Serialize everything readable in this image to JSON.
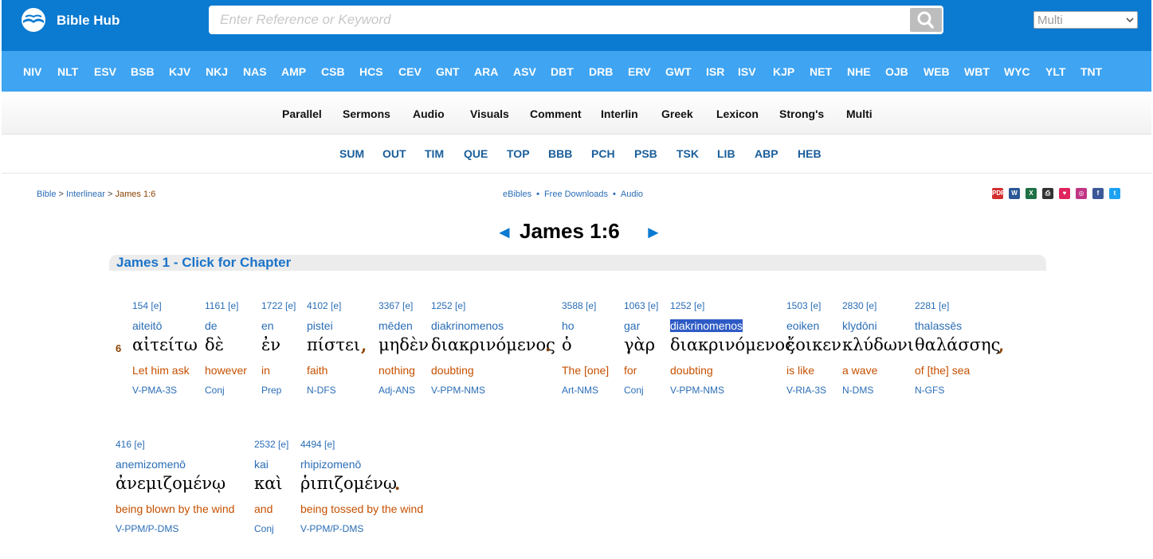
{
  "header": {
    "logo_text": "Bible Hub",
    "search_placeholder": "Enter Reference or Keyword",
    "select_value": "Multi"
  },
  "versions": [
    "NIV",
    "NLT",
    "ESV",
    "BSB",
    "KJV",
    "NKJ",
    "NAS",
    "AMP",
    "CSB",
    "HCS",
    "CEV",
    "GNT",
    "ARA",
    "ASV",
    "DBT",
    "DRB",
    "ERV",
    "GWT",
    "ISR",
    "ISV",
    "KJP",
    "NET",
    "NHE",
    "OJB",
    "WEB",
    "WBT",
    "WYC",
    "YLT",
    "TNT"
  ],
  "study_nav": [
    "Parallel",
    "Sermons",
    "Audio",
    "Visuals",
    "Comment",
    "Interlin",
    "Greek",
    "Lexicon",
    "Strong's",
    "Multi"
  ],
  "commentary_nav": [
    "SUM",
    "OUT",
    "TIM",
    "QUE",
    "TOP",
    "BBB",
    "PCH",
    "PSB",
    "TSK",
    "LIB",
    "ABP",
    "HEB"
  ],
  "breadcrumb": {
    "bible": "Bible",
    "sep": ">",
    "interlinear": "Interlinear",
    "current": "James 1:6"
  },
  "mid_links": [
    "eBibles",
    "Free Downloads",
    "Audio"
  ],
  "share_icons": [
    {
      "name": "pdf-icon",
      "label": "PDF",
      "color": "#d32f2f"
    },
    {
      "name": "word-icon",
      "label": "W",
      "color": "#2b5797"
    },
    {
      "name": "excel-icon",
      "label": "X",
      "color": "#1e7145"
    },
    {
      "name": "print-icon",
      "label": "⎙",
      "color": "#333333"
    },
    {
      "name": "heart-icon",
      "label": "♥",
      "color": "#e0245e"
    },
    {
      "name": "instagram-icon",
      "label": "◎",
      "color": "#c13584"
    },
    {
      "name": "facebook-icon",
      "label": "f",
      "color": "#3b5998"
    },
    {
      "name": "twitter-icon",
      "label": "t",
      "color": "#1da1f2"
    }
  ],
  "title": "James 1:6",
  "prev_arrow": "◄",
  "next_arrow": "►",
  "chapter_bar": "James 1 - Click for Chapter",
  "verse_number": "6",
  "words_row1": [
    {
      "strongs": "154 [e]",
      "translit": "aiteitō",
      "greek": "αἰτείτω",
      "english": "Let him ask",
      "parsing": "V-PMA-3S"
    },
    {
      "strongs": "1161 [e]",
      "translit": "de",
      "greek": "δὲ",
      "english": "however",
      "parsing": "Conj"
    },
    {
      "strongs": "1722 [e]",
      "translit": "en",
      "greek": "ἐν",
      "english": "in",
      "parsing": "Prep"
    },
    {
      "strongs": "4102 [e]",
      "translit": "pistei",
      "greek": "πίστει",
      "english": "faith",
      "parsing": "N-DFS"
    },
    {
      "strongs": "3367 [e]",
      "translit": "mēden",
      "greek": "μηδὲν",
      "english": "nothing",
      "parsing": "Adj-ANS"
    },
    {
      "strongs": "1252 [e]",
      "translit": "diakrinomenos",
      "greek": "διακρινόμενος",
      "english": "doubting",
      "parsing": "V-PPM-NMS"
    },
    {
      "strongs": "3588 [e]",
      "translit": "ho",
      "greek": "ὁ",
      "english": "The [one]",
      "parsing": "Art-NMS"
    },
    {
      "strongs": "1063 [e]",
      "translit": "gar",
      "greek": "γὰρ",
      "english": "for",
      "parsing": "Conj"
    },
    {
      "strongs": "1252 [e]",
      "translit": "diakrinomenos",
      "greek": "διακρινόμενος",
      "english": "doubting",
      "parsing": "V-PPM-NMS"
    },
    {
      "strongs": "1503 [e]",
      "translit": "eoiken",
      "greek": "ἔοικεν",
      "english": "is like",
      "parsing": "V-RIA-3S"
    },
    {
      "strongs": "2830 [e]",
      "translit": "klydōni",
      "greek": "κλύδωνι",
      "english": "a wave",
      "parsing": "N-DMS"
    },
    {
      "strongs": "2281 [e]",
      "translit": "thalassēs",
      "greek": "θαλάσσης",
      "english": "of [the] sea",
      "parsing": "N-GFS"
    }
  ],
  "words_row2": [
    {
      "strongs": "416 [e]",
      "translit": "anemizomenō",
      "greek": "ἀνεμιζομένῳ",
      "english": "being blown by the wind",
      "parsing": "V-PPM/P-DMS"
    },
    {
      "strongs": "2532 [e]",
      "translit": "kai",
      "greek": "καὶ",
      "english": "and",
      "parsing": "Conj"
    },
    {
      "strongs": "4494 [e]",
      "translit": "rhipizomenō",
      "greek": "ῥιπιζομένῳ",
      "english": "being tossed by the wind",
      "parsing": "V-PPM/P-DMS"
    }
  ],
  "punctuation": {
    "comma": ",",
    "period": "."
  }
}
